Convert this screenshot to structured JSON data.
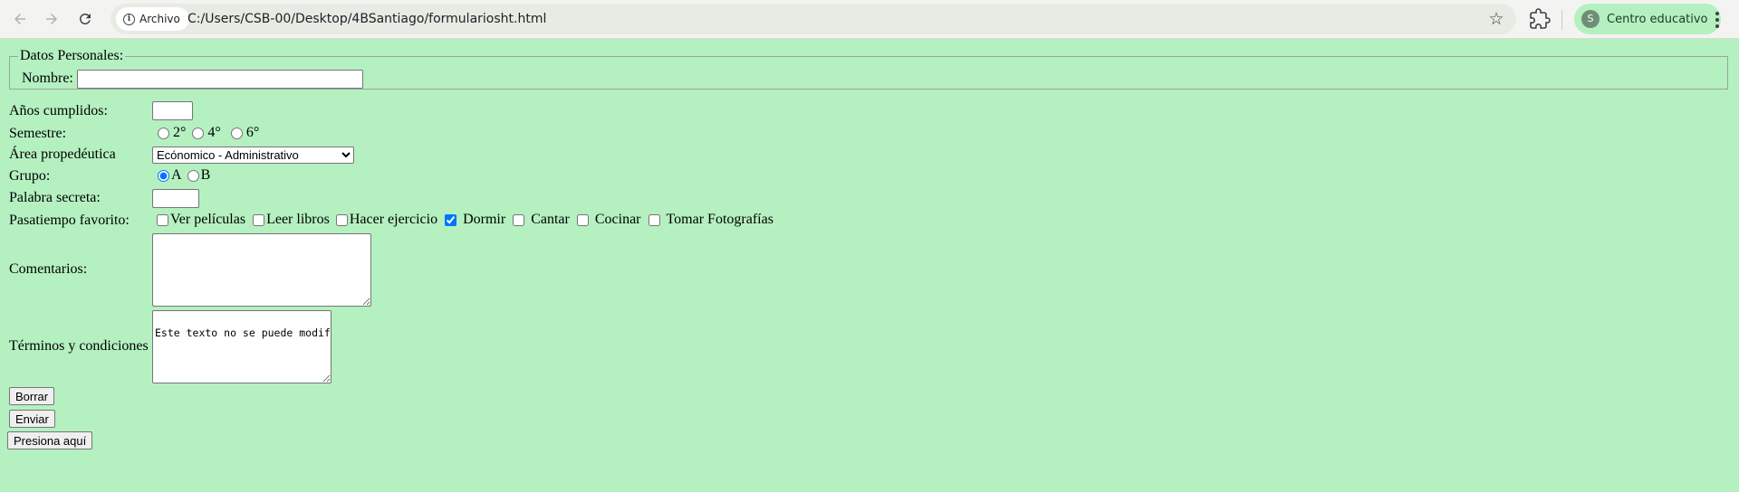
{
  "browser": {
    "chip_label": "Archivo",
    "url": "C:/Users/CSB-00/Desktop/4BSantiago/formulariosht.html",
    "profile_initial": "S",
    "profile_name": "Centro educativo"
  },
  "form": {
    "fieldset_legend": "Datos Personales:",
    "nombre_label": "Nombre:",
    "nombre_value": "",
    "edad_label": "Años cumplidos:",
    "edad_value": "",
    "semestre_label": "Semestre:",
    "semestre_options": [
      "2°",
      "4°",
      "6°"
    ],
    "area_label": "Área propedéutica",
    "area_selected": "Ecónomico - Administrativo",
    "grupo_label": "Grupo:",
    "grupo_options": [
      "A",
      "B"
    ],
    "grupo_selected": "A",
    "secreta_label": "Palabra secreta:",
    "secreta_value": "",
    "pasatiempo_label": "Pasatiempo favorito:",
    "pasatiempos": [
      {
        "label": "Ver películas",
        "checked": false
      },
      {
        "label": "Leer libros",
        "checked": false
      },
      {
        "label": "Hacer ejercicio",
        "checked": false
      },
      {
        "label": "Dormir",
        "checked": true
      },
      {
        "label": "Cantar",
        "checked": false
      },
      {
        "label": "Cocinar",
        "checked": false
      },
      {
        "label": "Tomar Fotografías",
        "checked": false
      }
    ],
    "comentarios_label": "Comentarios:",
    "comentarios_value": "",
    "terminos_label": "Términos y condiciones",
    "terminos_value": "Este texto no se puede modificar porque el objeto es de solo lectura.",
    "borrar_label": "Borrar",
    "enviar_label": "Enviar",
    "presiona_label": "Presiona aquí"
  },
  "colors": {
    "page_background": "#b4f0c0",
    "chrome_background": "#f3f4f1",
    "checkbox_accent": "#1a73e8"
  }
}
